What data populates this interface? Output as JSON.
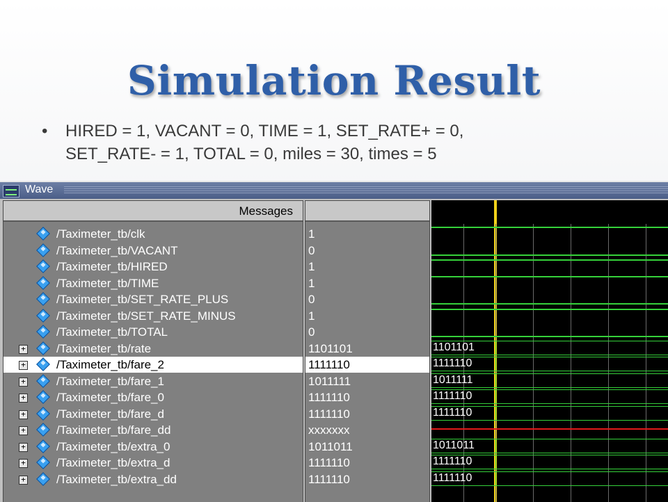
{
  "slide": {
    "title": "Simulation Result",
    "bullet_symbol": "•",
    "bullet_line1": "HIRED = 1, VACANT  = 0, TIME = 1, SET_RATE+ = 0,",
    "bullet_line2": "SET_RATE- = 1, TOTAL = 0, miles  = 30, times = 5"
  },
  "wave_window": {
    "title": "Wave",
    "messages_header": "Messages",
    "expand_symbol": "+",
    "signals": [
      {
        "name": "/Taximeter_tb/clk",
        "value": "1",
        "type": "bit",
        "expandable": false,
        "selected": false
      },
      {
        "name": "/Taximeter_tb/VACANT",
        "value": "0",
        "type": "bit",
        "expandable": false,
        "selected": false
      },
      {
        "name": "/Taximeter_tb/HIRED",
        "value": "1",
        "type": "bit",
        "expandable": false,
        "selected": false
      },
      {
        "name": "/Taximeter_tb/TIME",
        "value": "1",
        "type": "bit",
        "expandable": false,
        "selected": false
      },
      {
        "name": "/Taximeter_tb/SET_RATE_PLUS",
        "value": "0",
        "type": "bit",
        "expandable": false,
        "selected": false
      },
      {
        "name": "/Taximeter_tb/SET_RATE_MINUS",
        "value": "1",
        "type": "bit",
        "expandable": false,
        "selected": false
      },
      {
        "name": "/Taximeter_tb/TOTAL",
        "value": "0",
        "type": "bit",
        "expandable": false,
        "selected": false
      },
      {
        "name": "/Taximeter_tb/rate",
        "value": "1101101",
        "type": "bus",
        "expandable": true,
        "selected": false
      },
      {
        "name": "/Taximeter_tb/fare_2",
        "value": "1111110",
        "type": "bus",
        "expandable": true,
        "selected": true
      },
      {
        "name": "/Taximeter_tb/fare_1",
        "value": "1011111",
        "type": "bus",
        "expandable": true,
        "selected": false
      },
      {
        "name": "/Taximeter_tb/fare_0",
        "value": "1111110",
        "type": "bus",
        "expandable": true,
        "selected": false
      },
      {
        "name": "/Taximeter_tb/fare_d",
        "value": "1111110",
        "type": "bus",
        "expandable": true,
        "selected": false
      },
      {
        "name": "/Taximeter_tb/fare_dd",
        "value": "xxxxxxx",
        "type": "unknown",
        "expandable": true,
        "selected": false
      },
      {
        "name": "/Taximeter_tb/extra_0",
        "value": "1011011",
        "type": "bus",
        "expandable": true,
        "selected": false
      },
      {
        "name": "/Taximeter_tb/extra_d",
        "value": "1111110",
        "type": "bus",
        "expandable": true,
        "selected": false
      },
      {
        "name": "/Taximeter_tb/extra_dd",
        "value": "1111110",
        "type": "bus",
        "expandable": true,
        "selected": false
      }
    ],
    "colors": {
      "wave_high": "#35d13a",
      "cursor": "#f2d21a",
      "unknown": "#e11a1a",
      "icon": "#39a0f0"
    }
  }
}
